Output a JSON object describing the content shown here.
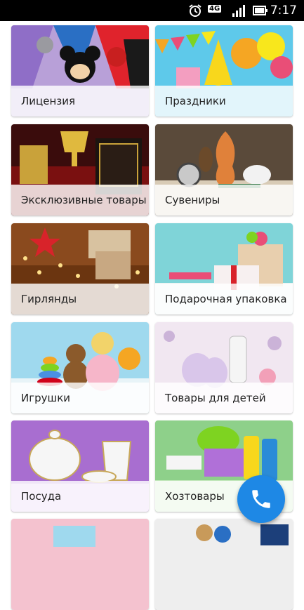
{
  "status_bar": {
    "time": "7:17",
    "network": "4G",
    "icons": [
      "alarm-icon",
      "network-4g-icon",
      "signal-icon",
      "battery-icon"
    ]
  },
  "categories": [
    {
      "label": "Лицензия"
    },
    {
      "label": "Праздники"
    },
    {
      "label": "Эксклюзивные товары"
    },
    {
      "label": "Сувениры"
    },
    {
      "label": "Гирлянды"
    },
    {
      "label": "Подарочная упаковка"
    },
    {
      "label": "Игрушки"
    },
    {
      "label": "Товары для детей"
    },
    {
      "label": "Посуда"
    },
    {
      "label": "Хозтовары"
    },
    {
      "label": ""
    },
    {
      "label": ""
    }
  ],
  "fab": {
    "icon": "phone-icon"
  },
  "colors": {
    "fab": "#1e88e5",
    "status_bar": "#000000",
    "label_bg": "#ffffff"
  }
}
